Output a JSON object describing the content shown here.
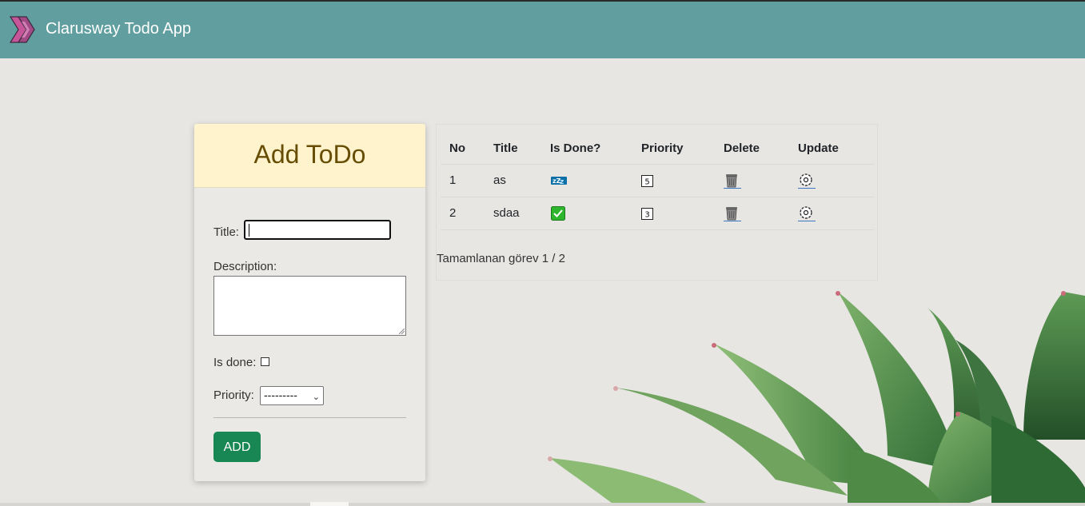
{
  "navbar": {
    "brand": "Clarusway Todo App",
    "logo_icon": "chevron-arrows-logo-icon",
    "background": "#619e9f"
  },
  "form": {
    "heading": "Add ToDo",
    "title_label": "Title:",
    "title_value": "",
    "description_label": "Description:",
    "description_value": "",
    "is_done_label": "Is done:",
    "is_done_checked": false,
    "priority_label": "Priority:",
    "priority_selected": "---------",
    "add_button": "ADD",
    "accent": "#198754",
    "heading_bg": "#fff3cd"
  },
  "table": {
    "headers": [
      "No",
      "Title",
      "Is Done?",
      "Priority",
      "Delete",
      "Update"
    ],
    "rows": [
      {
        "no": "1",
        "title": "as",
        "is_done_icon": "sleeping-zzz-icon",
        "priority": "5",
        "delete_icon": "trash-can-icon",
        "update_icon": "gear-icon"
      },
      {
        "no": "2",
        "title": "sdaa",
        "is_done_icon": "check-mark-icon",
        "priority": "3",
        "delete_icon": "trash-can-icon",
        "update_icon": "gear-icon"
      }
    ],
    "summary": "Tamamlanan görev 1 / 2"
  }
}
